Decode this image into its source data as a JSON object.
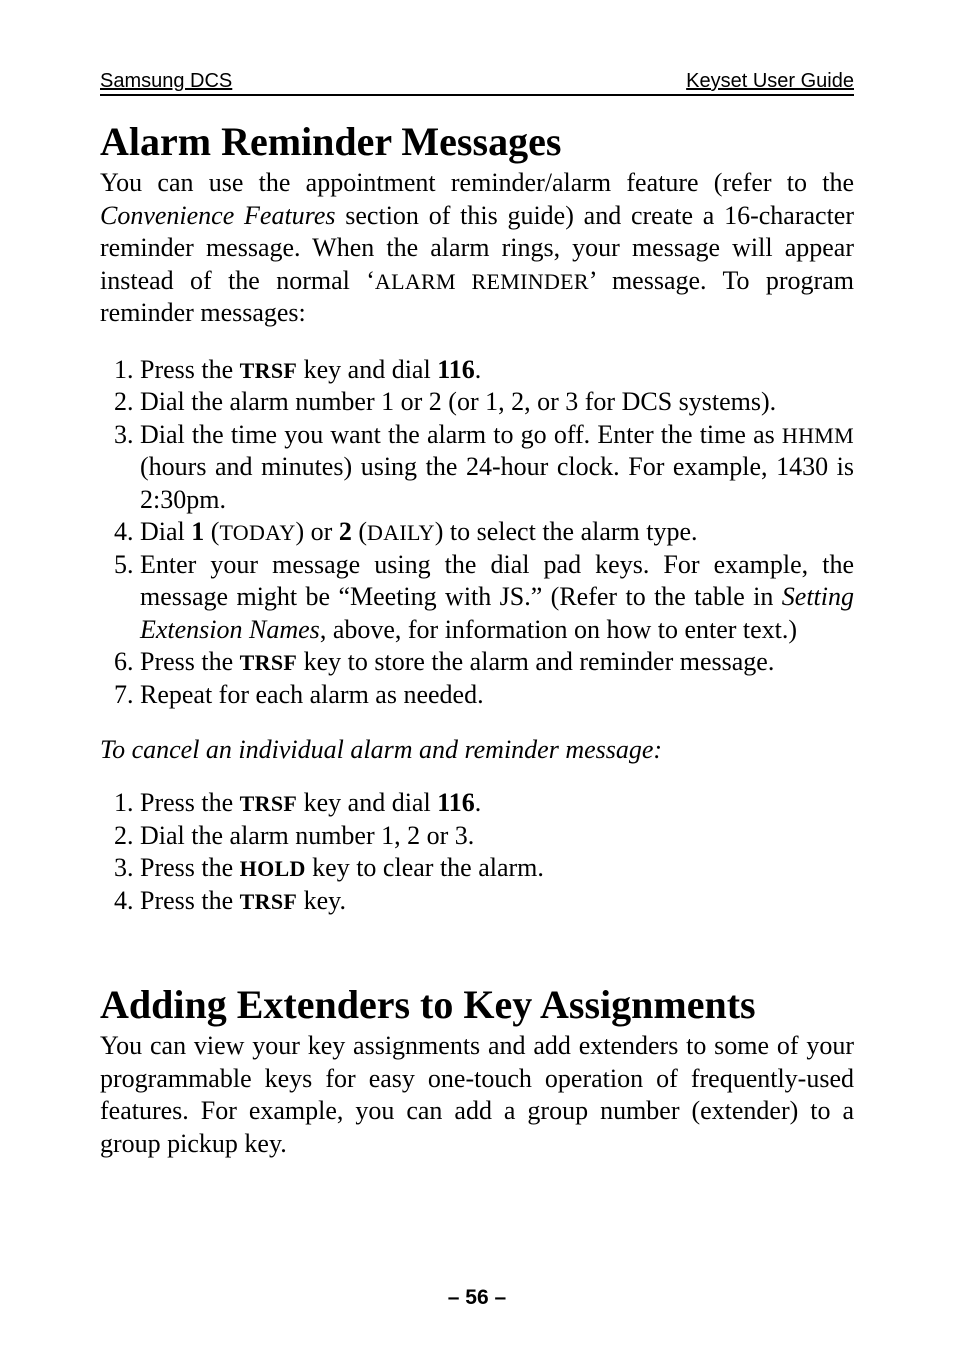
{
  "header": {
    "left": "Samsung DCS",
    "right": "Keyset User Guide"
  },
  "section1": {
    "title": "Alarm Reminder Messages",
    "intro": {
      "pre": "You can use the appointment reminder/alarm feature (refer to the ",
      "italic": "Convenience Features",
      "mid": " section of this guide) and create a 16-character reminder message. When the alarm rings, your message will appear instead of the normal ‘",
      "sc": "ALARM REMINDER",
      "post": "’ message. To program reminder messages:"
    },
    "steps": {
      "s1": {
        "a": "Press the ",
        "b": "TRSF",
        "c": " key and dial ",
        "d": "116",
        "e": "."
      },
      "s2": "Dial the alarm number 1 or 2 (or 1, 2, or 3 for DCS systems).",
      "s3": {
        "a": "Dial the time you want the alarm to go off. Enter the time as ",
        "b": "HHMM",
        "c": " (hours and minutes) using the 24-hour clock. For example, 1430 is 2:30pm."
      },
      "s4": {
        "a": "Dial ",
        "b": "1",
        "c": " (",
        "d": "TODAY",
        "e": ") or ",
        "f": "2",
        "g": " (",
        "h": "DAILY",
        "i": ") to select the alarm type."
      },
      "s5": {
        "a": "Enter your message using the dial pad keys. For example, the message might be “Meeting with JS.” (Refer to the table in ",
        "b": "Setting Extension Names",
        "c": ", above, for information on how to enter text.)"
      },
      "s6": {
        "a": "Press the ",
        "b": "TRSF",
        "c": " key to store the alarm and reminder message."
      },
      "s7": "Repeat for each alarm as needed."
    },
    "cancel_note": "To cancel an individual alarm and reminder message:",
    "cancel_steps": {
      "c1": {
        "a": "Press the ",
        "b": "TRSF",
        "c": " key and dial ",
        "d": "116",
        "e": "."
      },
      "c2": "Dial the alarm number 1, 2 or 3.",
      "c3": {
        "a": "Press the ",
        "b": "HOLD",
        "c": " key to clear the alarm."
      },
      "c4": {
        "a": "Press the ",
        "b": "TRSF",
        "c": " key."
      }
    }
  },
  "section2": {
    "title": "Adding Extenders to Key Assignments",
    "intro": "You can view your key assignments and add extenders to some of your programmable keys for easy one-touch operation of frequently-used features. For example, you can add a group number (extender) to a group pickup key."
  },
  "footer": {
    "page_number": "– 56 –"
  }
}
